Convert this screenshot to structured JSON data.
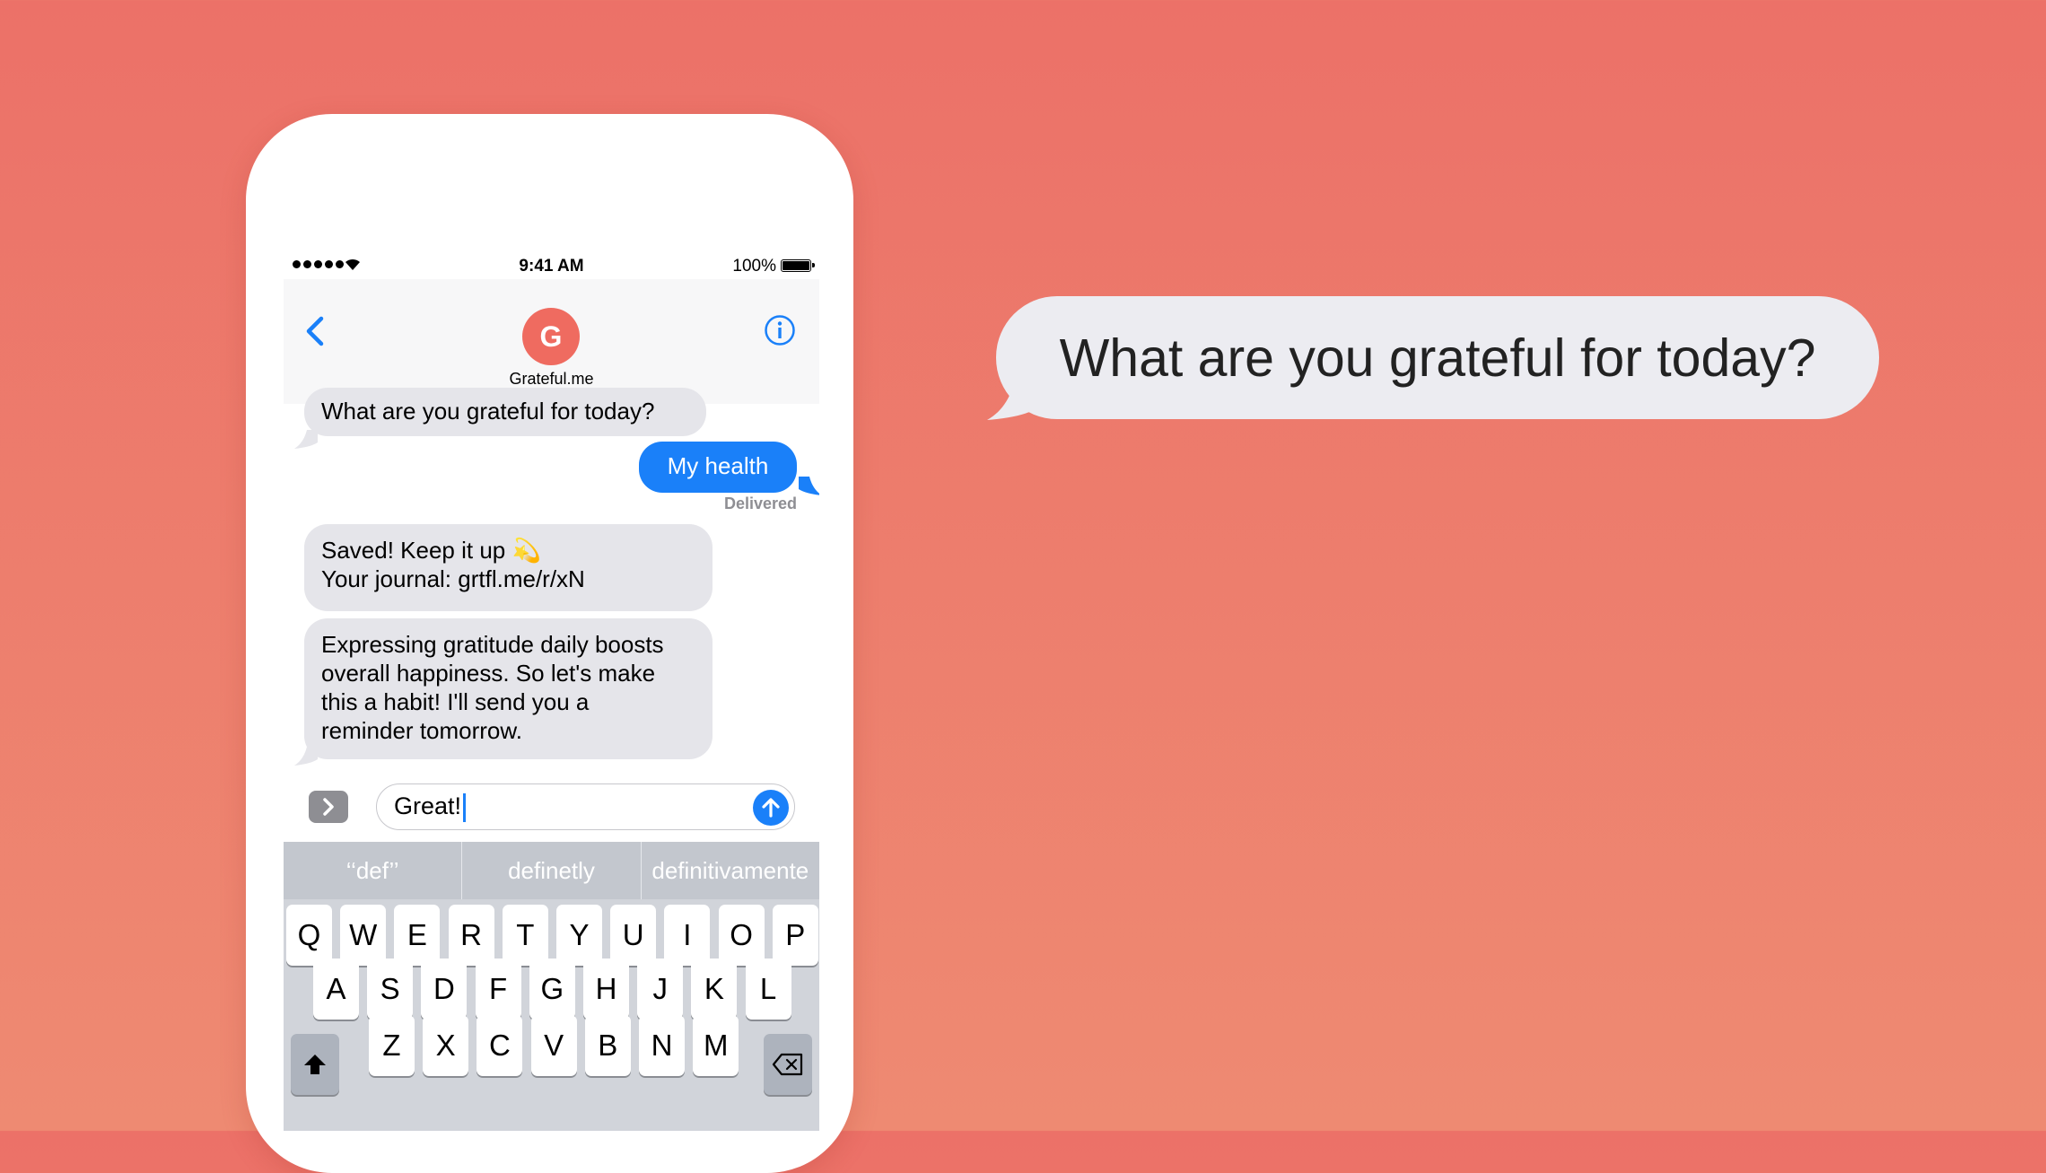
{
  "status": {
    "time": "9:41 AM",
    "battery": "100%"
  },
  "contact": {
    "initial": "G",
    "name": "Grateful.me"
  },
  "messages": [
    {
      "dir": "in",
      "lines": [
        "What are you grateful for today?"
      ]
    },
    {
      "dir": "out",
      "lines": [
        "My health"
      ]
    },
    {
      "dir": "in",
      "lines": [
        "Saved! Keep it up 💫",
        "Your journal: grtfl.me/r/xN"
      ]
    },
    {
      "dir": "in",
      "lines": [
        "Expressing gratitude daily boosts",
        "overall happiness. So let's make",
        "this a habit!  I'll send you a",
        "reminder tomorrow."
      ]
    }
  ],
  "delivered_label": "Delivered",
  "compose": {
    "value": "Great!"
  },
  "suggestions": [
    "‘‘def’’",
    "definetly",
    "definitivamente"
  ],
  "keyboard": {
    "row1": [
      "Q",
      "W",
      "E",
      "R",
      "T",
      "Y",
      "U",
      "I",
      "O",
      "P"
    ],
    "row2": [
      "A",
      "S",
      "D",
      "F",
      "G",
      "H",
      "J",
      "K",
      "L"
    ],
    "row3": [
      "Z",
      "X",
      "C",
      "V",
      "B",
      "N",
      "M"
    ]
  },
  "hero_bubble": "What are you grateful for today?",
  "colors": {
    "background": "#ec7168",
    "imessage_blue": "#1a80f9",
    "avatar": "#ef6b60"
  },
  "icons": [
    "back-chevron-icon",
    "info-icon",
    "app-drawer-icon",
    "send-arrow-icon",
    "shift-icon",
    "backspace-icon",
    "wifi-icon"
  ]
}
